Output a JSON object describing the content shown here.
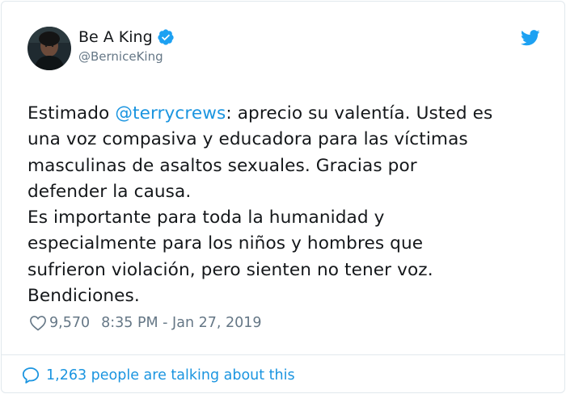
{
  "author": {
    "display_name": "Be A King",
    "handle": "@BerniceKing",
    "verified": true,
    "avatar_icon": "profile-photo"
  },
  "brand": {
    "icon": "twitter-bird-icon",
    "color": "#1da1f2"
  },
  "tweet": {
    "lines": [
      {
        "before": "Estimado ",
        "mention": "@terrycrews",
        "after": ": aprecio su valentía. Usted es"
      },
      {
        "text": "una voz compasiva y educadora para las víctimas"
      },
      {
        "text": "masculinas de asaltos sexuales. Gracias por"
      },
      {
        "text": "defender la causa."
      },
      {
        "text": "Es importante para toda la humanidad y"
      },
      {
        "text": "especialmente para los niños y hombres que"
      },
      {
        "text": "sufrieron violación, pero sienten no tener voz."
      },
      {
        "text": "Bendiciones."
      }
    ],
    "likes": "9,570",
    "timestamp": "8:35 PM - Jan 27, 2019"
  },
  "footer": {
    "conversation_text": "1,263 people are talking about this"
  },
  "colors": {
    "text": "#14171a",
    "secondary": "#657786",
    "link": "#1b95e0",
    "border": "#e1e8ed"
  }
}
